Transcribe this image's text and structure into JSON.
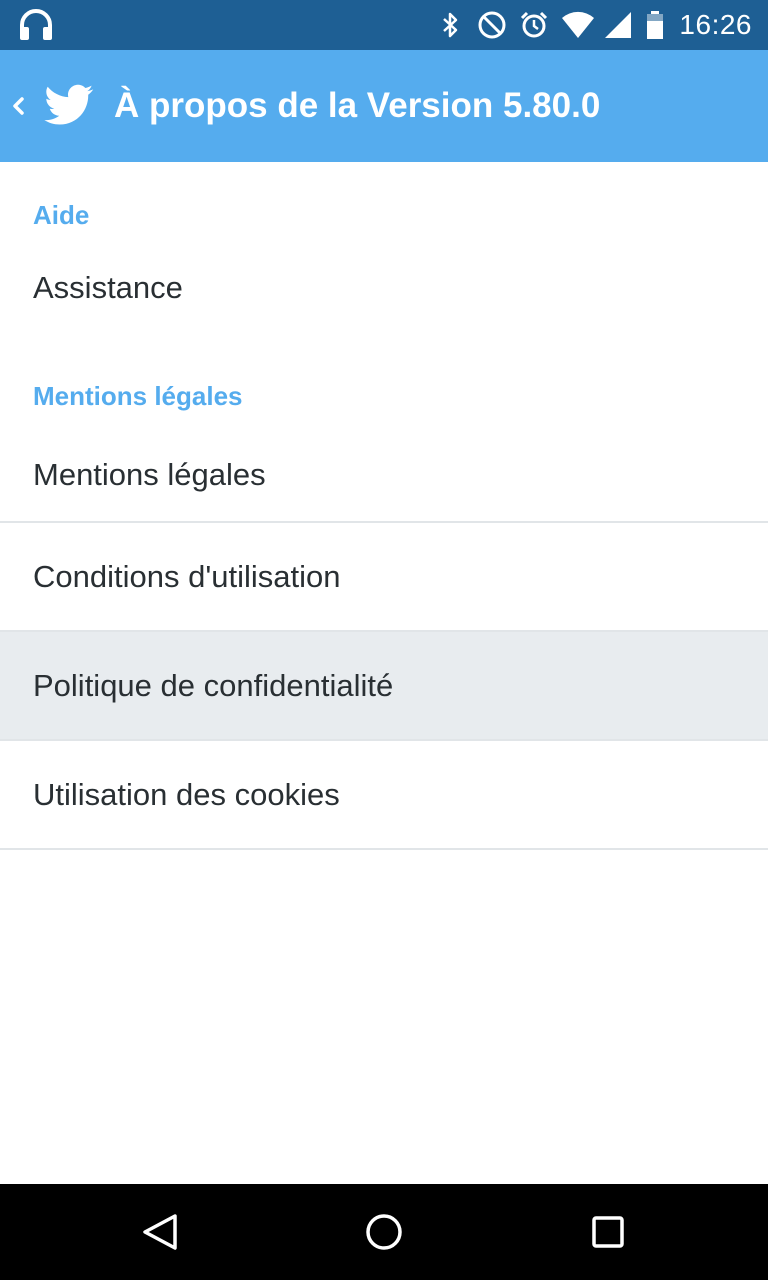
{
  "status_bar": {
    "time": "16:26",
    "left_icon": "headphones-icon",
    "right_icons": [
      "bluetooth-icon",
      "do-not-disturb-icon",
      "alarm-icon",
      "wifi-icon",
      "signal-icon",
      "battery-icon"
    ]
  },
  "app_bar": {
    "back_icon": "chevron-left-icon",
    "logo_icon": "twitter-bird-icon",
    "title": "À propos de la Version 5.80.0",
    "background_color": "#55acee"
  },
  "sections": {
    "help": {
      "header": "Aide",
      "items": [
        {
          "label": "Assistance"
        }
      ]
    },
    "legal": {
      "header": "Mentions légales",
      "items": [
        {
          "label": "Mentions légales"
        },
        {
          "label": "Conditions d'utilisation"
        },
        {
          "label": "Politique de confidentialité",
          "pressed": true
        },
        {
          "label": "Utilisation des cookies"
        }
      ]
    }
  },
  "nav_bar": {
    "back_icon": "nav-back-triangle-icon",
    "home_icon": "nav-home-circle-icon",
    "recents_icon": "nav-recents-square-icon"
  },
  "colors": {
    "status_bar": "#1e5f94",
    "accent": "#55acee",
    "text": "#292f33",
    "pressed_row": "#e8ecef"
  }
}
